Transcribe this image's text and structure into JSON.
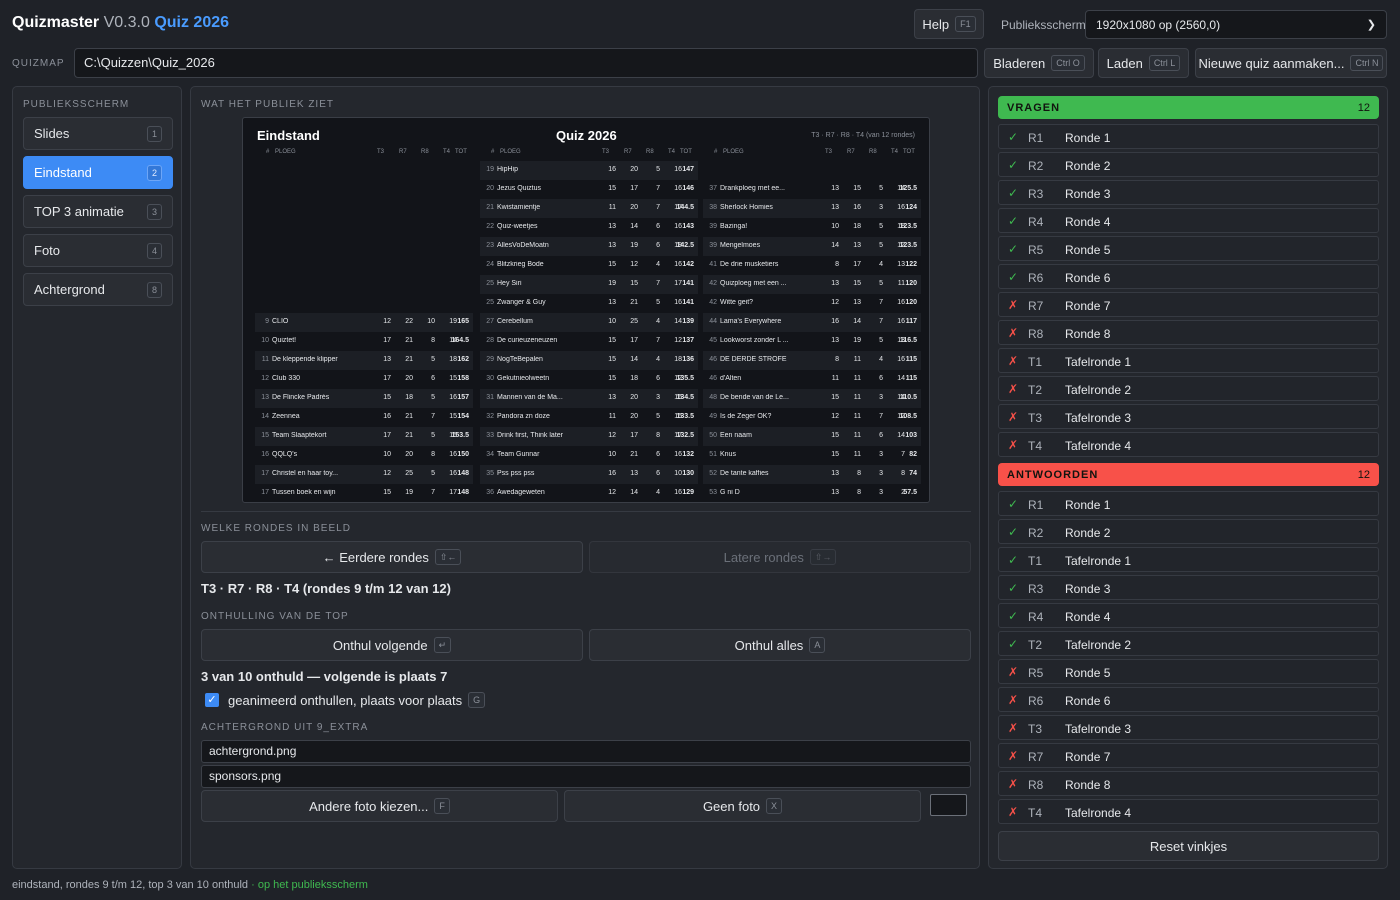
{
  "header": {
    "app_name": "Quizmaster",
    "version": "V0.3.0",
    "quiz_name": "Quiz 2026",
    "help_label": "Help",
    "help_key": "F1",
    "publiek_label": "Publieksscherm",
    "publiek_value": "1920x1080 op (2560,0)"
  },
  "quizmap": {
    "label": "QUIZMAP",
    "value": "C:\\Quizzen\\Quiz_2026",
    "browse_label": "Bladeren",
    "browse_key": "Ctrl O",
    "load_label": "Laden",
    "load_key": "Ctrl L",
    "new_label": "Nieuwe quiz aanmaken...",
    "new_key": "Ctrl N"
  },
  "sidebar": {
    "title": "PUBLIEKSSCHERM",
    "items": [
      {
        "label": "Slides",
        "key": "1"
      },
      {
        "label": "Eindstand",
        "key": "2"
      },
      {
        "label": "TOP 3 animatie",
        "key": "3"
      },
      {
        "label": "Foto",
        "key": "4"
      },
      {
        "label": "Achtergrond",
        "key": "8"
      }
    ]
  },
  "main": {
    "preview_title": "WAT HET PUBLIEK ZIET",
    "which_title": "WELKE RONDES IN BEELD",
    "earlier_label": "← Eerdere rondes",
    "earlier_key": "⇧←",
    "later_label": "Latere rondes",
    "later_key": "⇧→",
    "rounds_info": "T3 · R7 · R8 · T4 (rondes 9 t/m 12 van 12)",
    "reveal_title": "ONTHULLING VAN DE TOP",
    "reveal_next_label": "Onthul volgende",
    "reveal_next_key": "↵",
    "reveal_all_label": "Onthul alles",
    "reveal_all_key": "A",
    "reveal_info": "3 van 10 onthuld — volgende is plaats 7",
    "anim_label": "geanimeerd onthullen, plaats voor plaats",
    "anim_key": "G",
    "bg_title": "ACHTERGROND UIT 9_EXTRA",
    "files": [
      "achtergrond.png",
      "sponsors.png"
    ],
    "other_photo_label": "Andere foto kiezen...",
    "other_photo_key": "F",
    "no_photo_label": "Geen foto",
    "no_photo_key": "X"
  },
  "preview": {
    "title": "Eindstand",
    "quiz": "Quiz 2026",
    "subtitle": "T3 · R7 · R8 · T4 (van 12 rondes)",
    "headers": [
      "#",
      "PLOEG",
      "T3",
      "R7",
      "R8",
      "T4",
      "TOT"
    ],
    "columns": [
      [
        {
          "r": "9",
          "n": "CLIO",
          "v": [
            "12",
            "22",
            "10",
            "19"
          ],
          "t": "165"
        },
        {
          "r": "10",
          "n": "Quiztet!",
          "v": [
            "17",
            "21",
            "8",
            "14"
          ],
          "t": "164.5"
        },
        {
          "r": "11",
          "n": "De kleppende klipper",
          "v": [
            "13",
            "21",
            "5",
            "18"
          ],
          "t": "162"
        },
        {
          "r": "12",
          "n": "Club 330",
          "v": [
            "17",
            "20",
            "6",
            "15"
          ],
          "t": "158"
        },
        {
          "r": "13",
          "n": "De Flincke Padrés",
          "v": [
            "15",
            "18",
            "5",
            "16"
          ],
          "t": "157"
        },
        {
          "r": "14",
          "n": "Zeennea",
          "v": [
            "16",
            "21",
            "7",
            "15"
          ],
          "t": "154"
        },
        {
          "r": "15",
          "n": "Team Slaaptekort",
          "v": [
            "17",
            "21",
            "5",
            "15"
          ],
          "t": "153.5"
        },
        {
          "r": "16",
          "n": "QQLQ's",
          "v": [
            "10",
            "20",
            "8",
            "16"
          ],
          "t": "150"
        },
        {
          "r": "17",
          "n": "Christel en haar toy...",
          "v": [
            "12",
            "25",
            "5",
            "16"
          ],
          "t": "148"
        },
        {
          "r": "17",
          "n": "Tussen boek en wijn",
          "v": [
            "15",
            "19",
            "7",
            "17"
          ],
          "t": "148"
        }
      ],
      [
        {
          "r": "19",
          "n": "HipHip",
          "v": [
            "16",
            "20",
            "5",
            "16"
          ],
          "t": "147"
        },
        {
          "r": "20",
          "n": "Jezus Quiztus",
          "v": [
            "15",
            "17",
            "7",
            "16"
          ],
          "t": "146"
        },
        {
          "r": "21",
          "n": "Kwistamientje",
          "v": [
            "11",
            "20",
            "7",
            "17"
          ],
          "t": "144.5"
        },
        {
          "r": "22",
          "n": "Quiz-weetjes",
          "v": [
            "13",
            "14",
            "6",
            "16"
          ],
          "t": "143"
        },
        {
          "r": "23",
          "n": "AllesVoDeMoatn",
          "v": [
            "13",
            "19",
            "6",
            "18"
          ],
          "t": "142.5"
        },
        {
          "r": "24",
          "n": "Blitzkrieg Bode",
          "v": [
            "15",
            "12",
            "4",
            "16"
          ],
          "t": "142"
        },
        {
          "r": "25",
          "n": "Hey Siri",
          "v": [
            "19",
            "15",
            "7",
            "17"
          ],
          "t": "141"
        },
        {
          "r": "25",
          "n": "Zwanger & Guy",
          "v": [
            "13",
            "21",
            "5",
            "16"
          ],
          "t": "141"
        },
        {
          "r": "27",
          "n": "Cerebellum",
          "v": [
            "10",
            "25",
            "4",
            "14"
          ],
          "t": "139"
        },
        {
          "r": "28",
          "n": "De curieuzeneuzen",
          "v": [
            "15",
            "17",
            "7",
            "12"
          ],
          "t": "137"
        },
        {
          "r": "29",
          "n": "NogTeBepalen",
          "v": [
            "15",
            "14",
            "4",
            "18"
          ],
          "t": "136"
        },
        {
          "r": "30",
          "n": "Gekutnieolweetn",
          "v": [
            "15",
            "18",
            "6",
            "12"
          ],
          "t": "135.5"
        },
        {
          "r": "31",
          "n": "Mannen van de Ma...",
          "v": [
            "13",
            "20",
            "3",
            "16"
          ],
          "t": "134.5"
        },
        {
          "r": "32",
          "n": "Pandora zn doze",
          "v": [
            "11",
            "20",
            "5",
            "15"
          ],
          "t": "133.5"
        },
        {
          "r": "33",
          "n": "Drink first, Think later",
          "v": [
            "12",
            "17",
            "8",
            "17"
          ],
          "t": "132.5"
        },
        {
          "r": "34",
          "n": "Team Gunnar",
          "v": [
            "10",
            "21",
            "6",
            "16"
          ],
          "t": "132"
        },
        {
          "r": "35",
          "n": "Pss pss pss",
          "v": [
            "16",
            "13",
            "6",
            "10"
          ],
          "t": "130"
        },
        {
          "r": "36",
          "n": "Awedageweten",
          "v": [
            "12",
            "14",
            "4",
            "16"
          ],
          "t": "129"
        }
      ],
      [
        {
          "r": "37",
          "n": "Drankploeg met ee...",
          "v": [
            "13",
            "15",
            "5",
            "14"
          ],
          "t": "125.5"
        },
        {
          "r": "38",
          "n": "Sherlock Homies",
          "v": [
            "13",
            "16",
            "3",
            "16"
          ],
          "t": "124"
        },
        {
          "r": "39",
          "n": "Bazinga!",
          "v": [
            "10",
            "18",
            "5",
            "18"
          ],
          "t": "123.5"
        },
        {
          "r": "39",
          "n": "Mengelmoes",
          "v": [
            "14",
            "13",
            "5",
            "12"
          ],
          "t": "123.5"
        },
        {
          "r": "41",
          "n": "De drie musketiers",
          "v": [
            "8",
            "17",
            "4",
            "13"
          ],
          "t": "122"
        },
        {
          "r": "42",
          "n": "Quizploeg met een ...",
          "v": [
            "13",
            "15",
            "5",
            "11"
          ],
          "t": "120"
        },
        {
          "r": "42",
          "n": "Witte geit?",
          "v": [
            "12",
            "13",
            "7",
            "16"
          ],
          "t": "120"
        },
        {
          "r": "44",
          "n": "Lama's Everywhere",
          "v": [
            "16",
            "14",
            "7",
            "16"
          ],
          "t": "117"
        },
        {
          "r": "45",
          "n": "Lookworst zonder L ...",
          "v": [
            "13",
            "19",
            "5",
            "13"
          ],
          "t": "116.5"
        },
        {
          "r": "46",
          "n": "DE DERDE STROFE",
          "v": [
            "8",
            "11",
            "4",
            "16"
          ],
          "t": "115"
        },
        {
          "r": "46",
          "n": "d'Alten",
          "v": [
            "11",
            "11",
            "6",
            "14"
          ],
          "t": "115"
        },
        {
          "r": "48",
          "n": "De bende van de Le...",
          "v": [
            "15",
            "11",
            "3",
            "14"
          ],
          "t": "110.5"
        },
        {
          "r": "49",
          "n": "Is de Zeger OK?",
          "v": [
            "12",
            "11",
            "7",
            "12"
          ],
          "t": "108.5"
        },
        {
          "r": "50",
          "n": "Een naam",
          "v": [
            "15",
            "11",
            "6",
            "14"
          ],
          "t": "103"
        },
        {
          "r": "51",
          "n": "Knus",
          "v": [
            "15",
            "11",
            "3",
            "7"
          ],
          "t": "82"
        },
        {
          "r": "52",
          "n": "De tante kaffies",
          "v": [
            "13",
            "8",
            "3",
            "8"
          ],
          "t": "74"
        },
        {
          "r": "53",
          "n": "G ni D",
          "v": [
            "13",
            "8",
            "3",
            "2"
          ],
          "t": "57.5"
        }
      ]
    ]
  },
  "right": {
    "vragen_title": "VRAGEN",
    "vragen_count": "12",
    "vragen": [
      {
        "ok": true,
        "code": "R1",
        "name": "Ronde 1"
      },
      {
        "ok": true,
        "code": "R2",
        "name": "Ronde 2"
      },
      {
        "ok": true,
        "code": "R3",
        "name": "Ronde 3"
      },
      {
        "ok": true,
        "code": "R4",
        "name": "Ronde 4"
      },
      {
        "ok": true,
        "code": "R5",
        "name": "Ronde 5"
      },
      {
        "ok": true,
        "code": "R6",
        "name": "Ronde 6"
      },
      {
        "ok": false,
        "code": "R7",
        "name": "Ronde 7"
      },
      {
        "ok": false,
        "code": "R8",
        "name": "Ronde 8"
      },
      {
        "ok": false,
        "code": "T1",
        "name": "Tafelronde 1"
      },
      {
        "ok": false,
        "code": "T2",
        "name": "Tafelronde 2"
      },
      {
        "ok": false,
        "code": "T3",
        "name": "Tafelronde 3"
      },
      {
        "ok": false,
        "code": "T4",
        "name": "Tafelronde 4"
      }
    ],
    "antw_title": "ANTWOORDEN",
    "antw_count": "12",
    "antwoorden": [
      {
        "ok": true,
        "code": "R1",
        "name": "Ronde 1"
      },
      {
        "ok": true,
        "code": "R2",
        "name": "Ronde 2"
      },
      {
        "ok": true,
        "code": "T1",
        "name": "Tafelronde 1"
      },
      {
        "ok": true,
        "code": "R3",
        "name": "Ronde 3"
      },
      {
        "ok": true,
        "code": "R4",
        "name": "Ronde 4"
      },
      {
        "ok": true,
        "code": "T2",
        "name": "Tafelronde 2"
      },
      {
        "ok": false,
        "code": "R5",
        "name": "Ronde 5"
      },
      {
        "ok": false,
        "code": "R6",
        "name": "Ronde 6"
      },
      {
        "ok": false,
        "code": "T3",
        "name": "Tafelronde 3"
      },
      {
        "ok": false,
        "code": "R7",
        "name": "Ronde 7"
      },
      {
        "ok": false,
        "code": "R8",
        "name": "Ronde 8"
      },
      {
        "ok": false,
        "code": "T4",
        "name": "Tafelronde 4"
      }
    ],
    "reset_label": "Reset vinkjes",
    "check_mark": "✓",
    "cross_mark": "✗"
  },
  "status": {
    "text": "eindstand, rondes 9 t/m 12, top 3 van 10 onthuld",
    "sep": " · ",
    "live": "op het publieksscherm"
  }
}
